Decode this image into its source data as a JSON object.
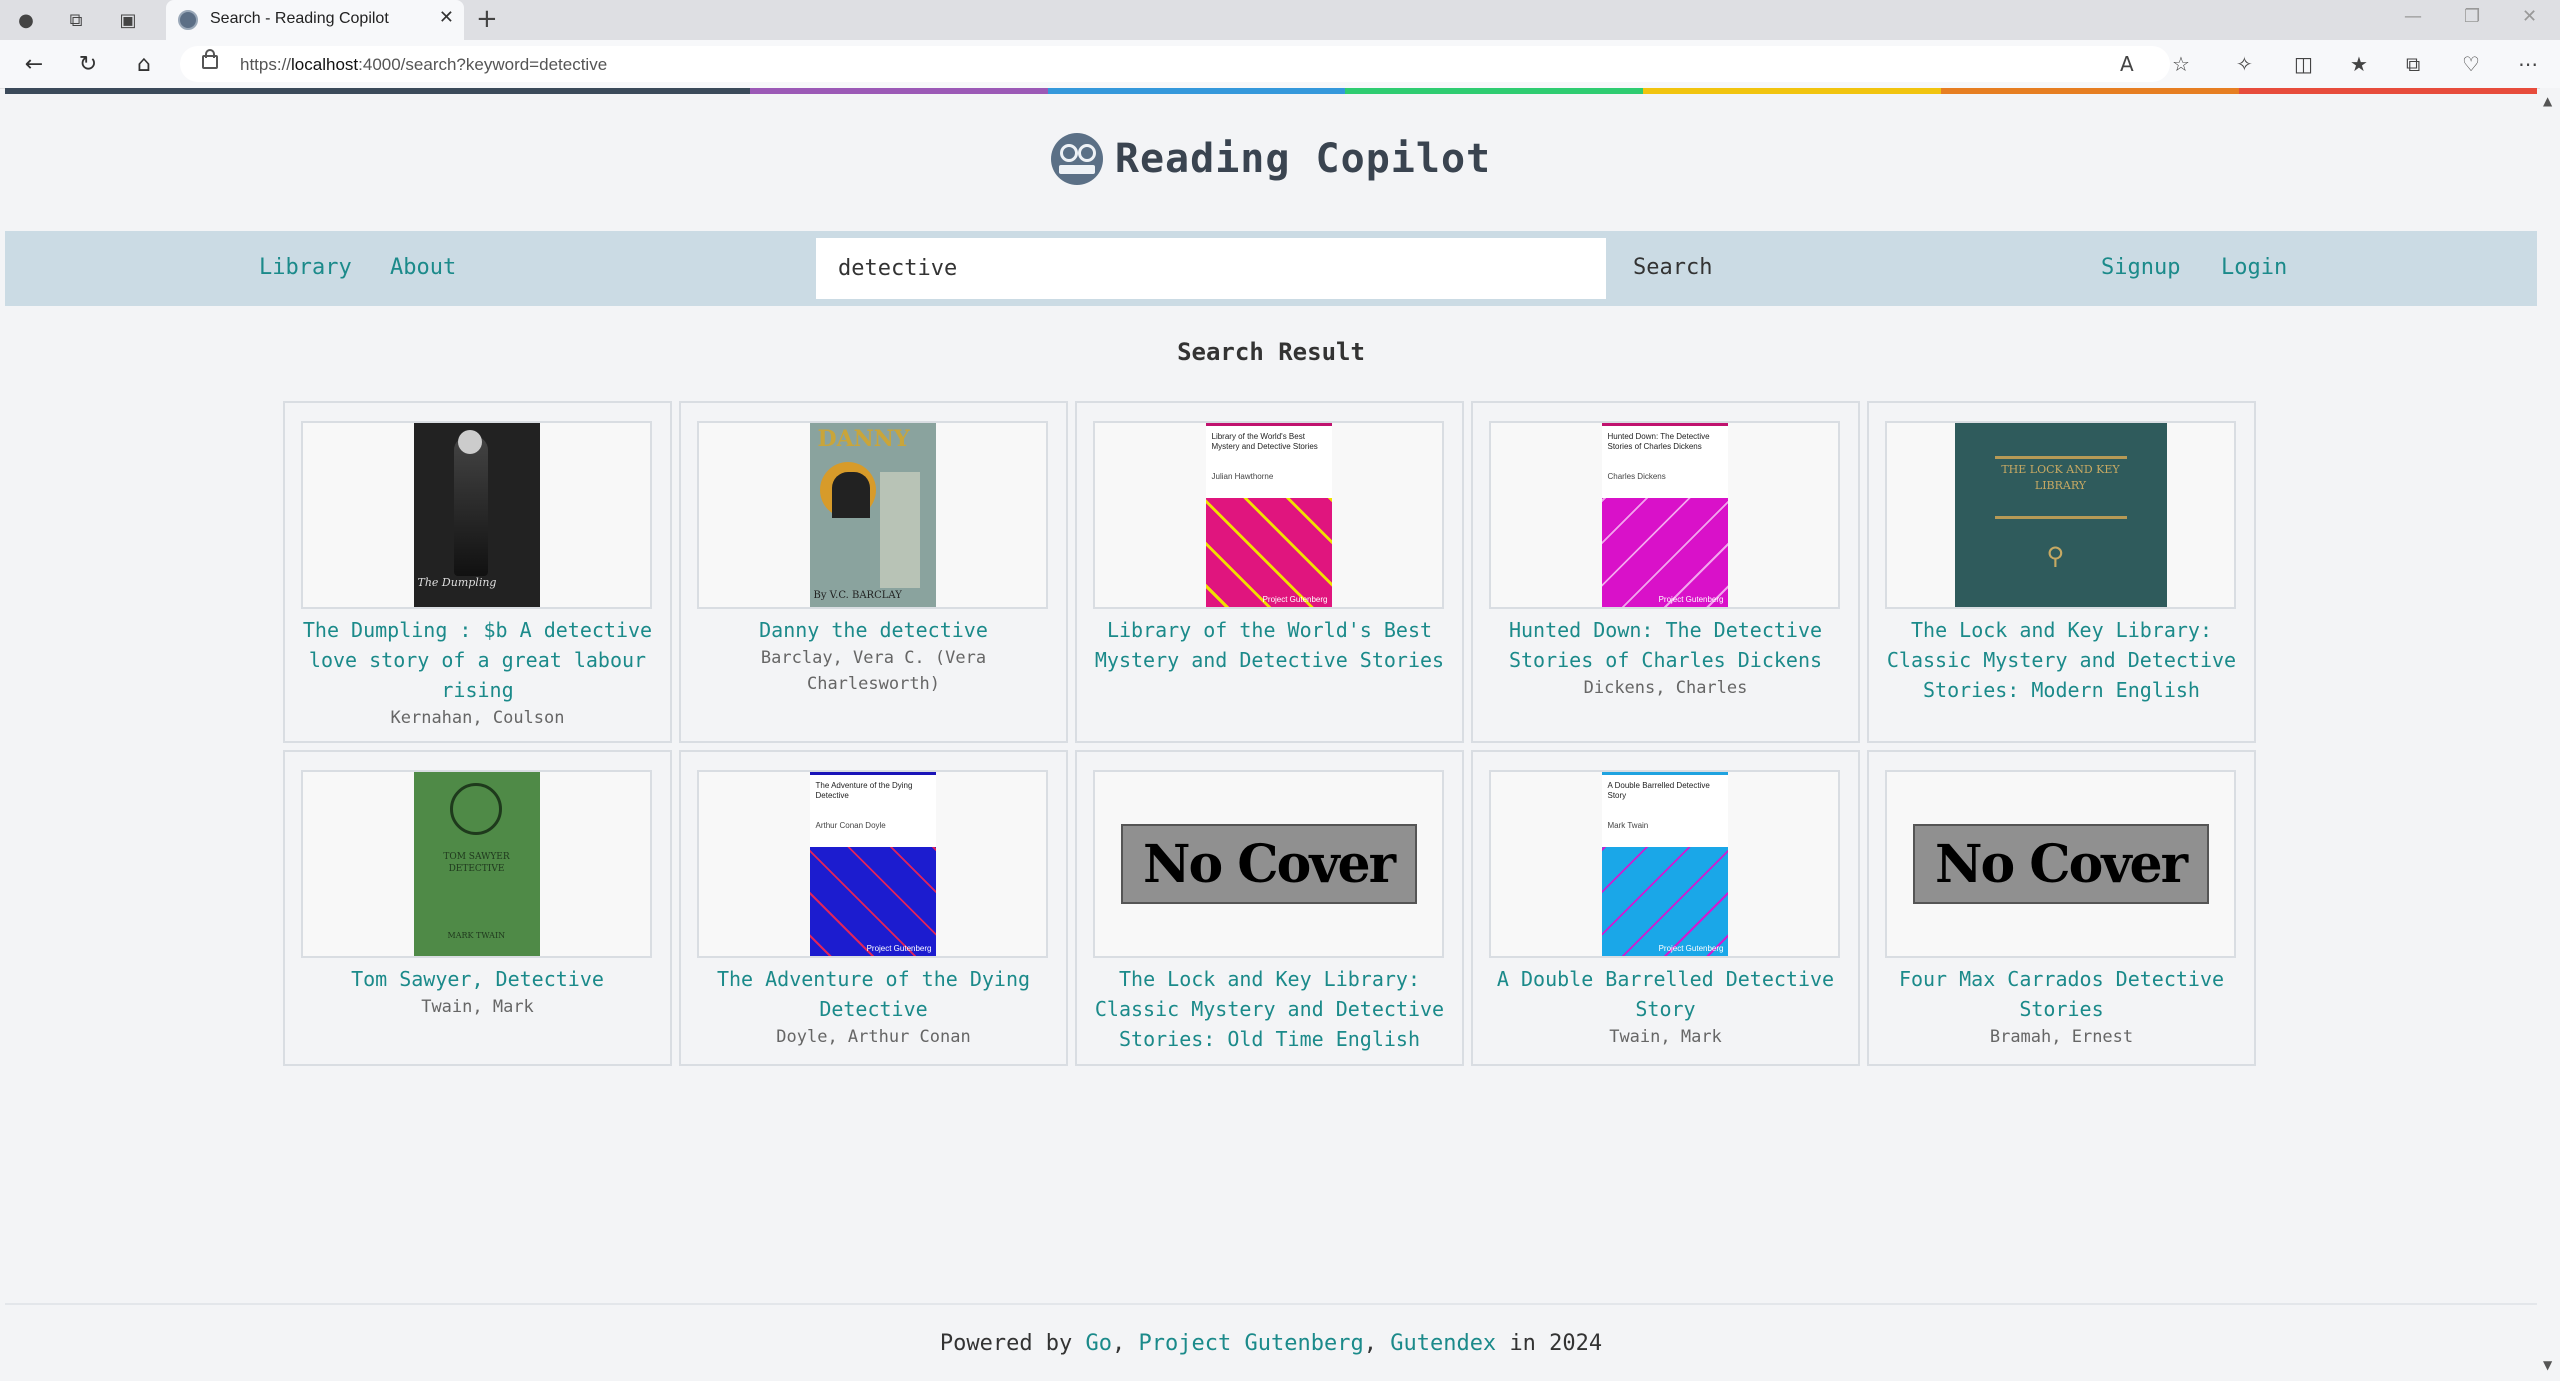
{
  "browser": {
    "tab_title": "Search - Reading Copilot",
    "url_prefix": "https://",
    "url_host": "localhost",
    "url_rest": ":4000/search?keyword=detective"
  },
  "brand": {
    "title": "Reading Copilot"
  },
  "nav": {
    "library": "Library",
    "about": "About",
    "search_value": "detective",
    "search_button": "Search",
    "signup": "Signup",
    "login": "Login"
  },
  "section_title": "Search Result",
  "books": [
    {
      "title": "The Dumpling : $b A detective love story of a great labour rising",
      "author": "Kernahan, Coulson",
      "cover_text": "The Dumpling"
    },
    {
      "title": "Danny the detective",
      "author": "Barclay, Vera C. (Vera Charlesworth)",
      "cover_text": "DANNY",
      "cover_sub": "By V.C. BARCLAY"
    },
    {
      "title": "Library of the World's Best Mystery and Detective Stories",
      "author": "",
      "cover_title": "Library of the World's Best Mystery and Detective Stories",
      "cover_author": "Julian Hawthorne",
      "cover_foot": "Project Gutenberg"
    },
    {
      "title": "Hunted Down: The Detective Stories of Charles Dickens",
      "author": "Dickens, Charles",
      "cover_title": "Hunted Down: The Detective Stories of Charles Dickens",
      "cover_author": "Charles Dickens",
      "cover_foot": "Project Gutenberg"
    },
    {
      "title": "The Lock and Key Library: Classic Mystery and Detective Stories: Modern English",
      "author": "",
      "cover_text": "THE LOCK AND KEY LIBRARY"
    },
    {
      "title": "Tom Sawyer, Detective",
      "author": "Twain, Mark",
      "cover_text": "TOM SAWYER DETECTIVE",
      "cover_sub": "MARK TWAIN"
    },
    {
      "title": "The Adventure of the Dying Detective",
      "author": "Doyle, Arthur Conan",
      "cover_title": "The Adventure of the Dying Detective",
      "cover_author": "Arthur Conan Doyle",
      "cover_foot": "Project Gutenberg"
    },
    {
      "title": "The Lock and Key Library: Classic Mystery and Detective Stories: Old Time English",
      "author": "",
      "no_cover": "No Cover"
    },
    {
      "title": "A Double Barrelled Detective Story",
      "author": "Twain, Mark",
      "cover_title": "A Double Barrelled Detective Story",
      "cover_author": "Mark Twain",
      "cover_foot": "Project Gutenberg"
    },
    {
      "title": "Four Max Carrados Detective Stories",
      "author": "Bramah, Ernest",
      "no_cover": "No Cover"
    }
  ],
  "footer": {
    "powered": "Powered by",
    "go": "Go",
    "sep1": ",",
    "gutenberg": "Project Gutenberg",
    "sep2": ",",
    "gutendex": "Gutendex",
    "year_text": "in 2024"
  },
  "colors": {
    "accent_link": "#1b8a8a",
    "navbar_bg": "#cbdbe4",
    "rainbow": [
      "#3b4a5a",
      "#9b59b6",
      "#3498db",
      "#2ecc71",
      "#f1c40f",
      "#e67e22",
      "#e74c3c"
    ]
  }
}
